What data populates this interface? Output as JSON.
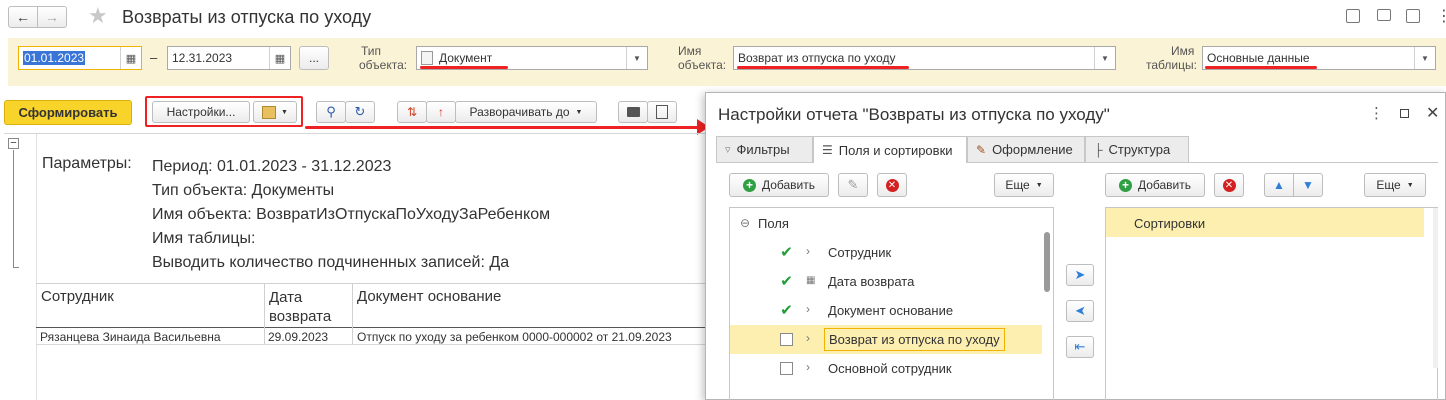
{
  "window": {
    "title": "Возвраты из отпуска по уходу"
  },
  "filters": {
    "date_from": "01.01.2023",
    "date_to": "12.31.2023",
    "date_sep": "–",
    "more_label": "...",
    "object_type_label_1": "Тип",
    "object_type_label_2": "объекта:",
    "object_type_value": "Документ",
    "object_name_label_1": "Имя",
    "object_name_label_2": "объекта:",
    "object_name_value": "Возврат из отпуска по уходу",
    "table_name_label_1": "Имя",
    "table_name_label_2": "таблицы:",
    "table_name_value": "Основные данные"
  },
  "toolbar": {
    "generate_label": "Сформировать",
    "settings_label": "Настройки...",
    "expand_label": "Разворачивать до"
  },
  "report": {
    "params_label": "Параметры:",
    "params": [
      "Период: 01.01.2023 - 31.12.2023",
      "Тип объекта: Документы",
      "Имя объекта: ВозвратИзОтпускаПоУходуЗаРебенком",
      "Имя таблицы:",
      "Выводить количество подчиненных записей: Да"
    ],
    "headers": [
      "Сотрудник",
      "Дата\nвозврата",
      "Документ основание"
    ],
    "rows": [
      [
        "Рязанцева Зинаида Васильевна",
        "29.09.2023",
        "Отпуск по уходу за ребенком 0000-000002 от 21.09.2023"
      ]
    ]
  },
  "dialog": {
    "title": "Настройки отчета \"Возвраты из отпуска по уходу\"",
    "tabs": [
      "Фильтры",
      "Поля и сортировки",
      "Оформление",
      "Структура"
    ],
    "left": {
      "add_label": "Добавить",
      "more_label": "Еще",
      "root_label": "Поля",
      "items": [
        {
          "label": "Сотрудник",
          "checked": true
        },
        {
          "label": "Дата возврата",
          "checked": true
        },
        {
          "label": "Документ основание",
          "checked": true
        },
        {
          "label": "Возврат из отпуска по уходу",
          "checked": false
        },
        {
          "label": "Основной сотрудник",
          "checked": false
        }
      ]
    },
    "right": {
      "add_label": "Добавить",
      "more_label": "Еще",
      "sort_label": "Сортировки"
    }
  },
  "colors": {
    "accent_yellow": "#f5c518",
    "filter_bar_bg": "#fbf3d5",
    "highlight": "#fcefb0",
    "red_mark": "#e22222"
  }
}
